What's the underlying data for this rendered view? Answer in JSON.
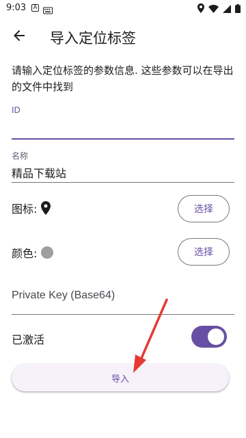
{
  "status_bar": {
    "time": "9:03",
    "left_icon_1": "A",
    "left_icon_2": "keyboard-icon"
  },
  "app_bar": {
    "title": "导入定位标签"
  },
  "description": "请输入定位标签的参数信息. 这些参数可以在导出的文件中找到",
  "fields": {
    "id": {
      "label": "ID",
      "value": ""
    },
    "name": {
      "label": "名称",
      "value": "精品下载站"
    },
    "private_key": {
      "placeholder": "Private Key (Base64)"
    }
  },
  "icon_row": {
    "label": "图标:",
    "button": "选择"
  },
  "color_row": {
    "label": "颜色:",
    "button": "选择",
    "color": "#9e9e9e"
  },
  "active_row": {
    "label": "已激活",
    "enabled": true
  },
  "import_button": {
    "label": "导入"
  },
  "colors": {
    "accent": "#6750a4",
    "annotation_arrow": "#e53935"
  }
}
